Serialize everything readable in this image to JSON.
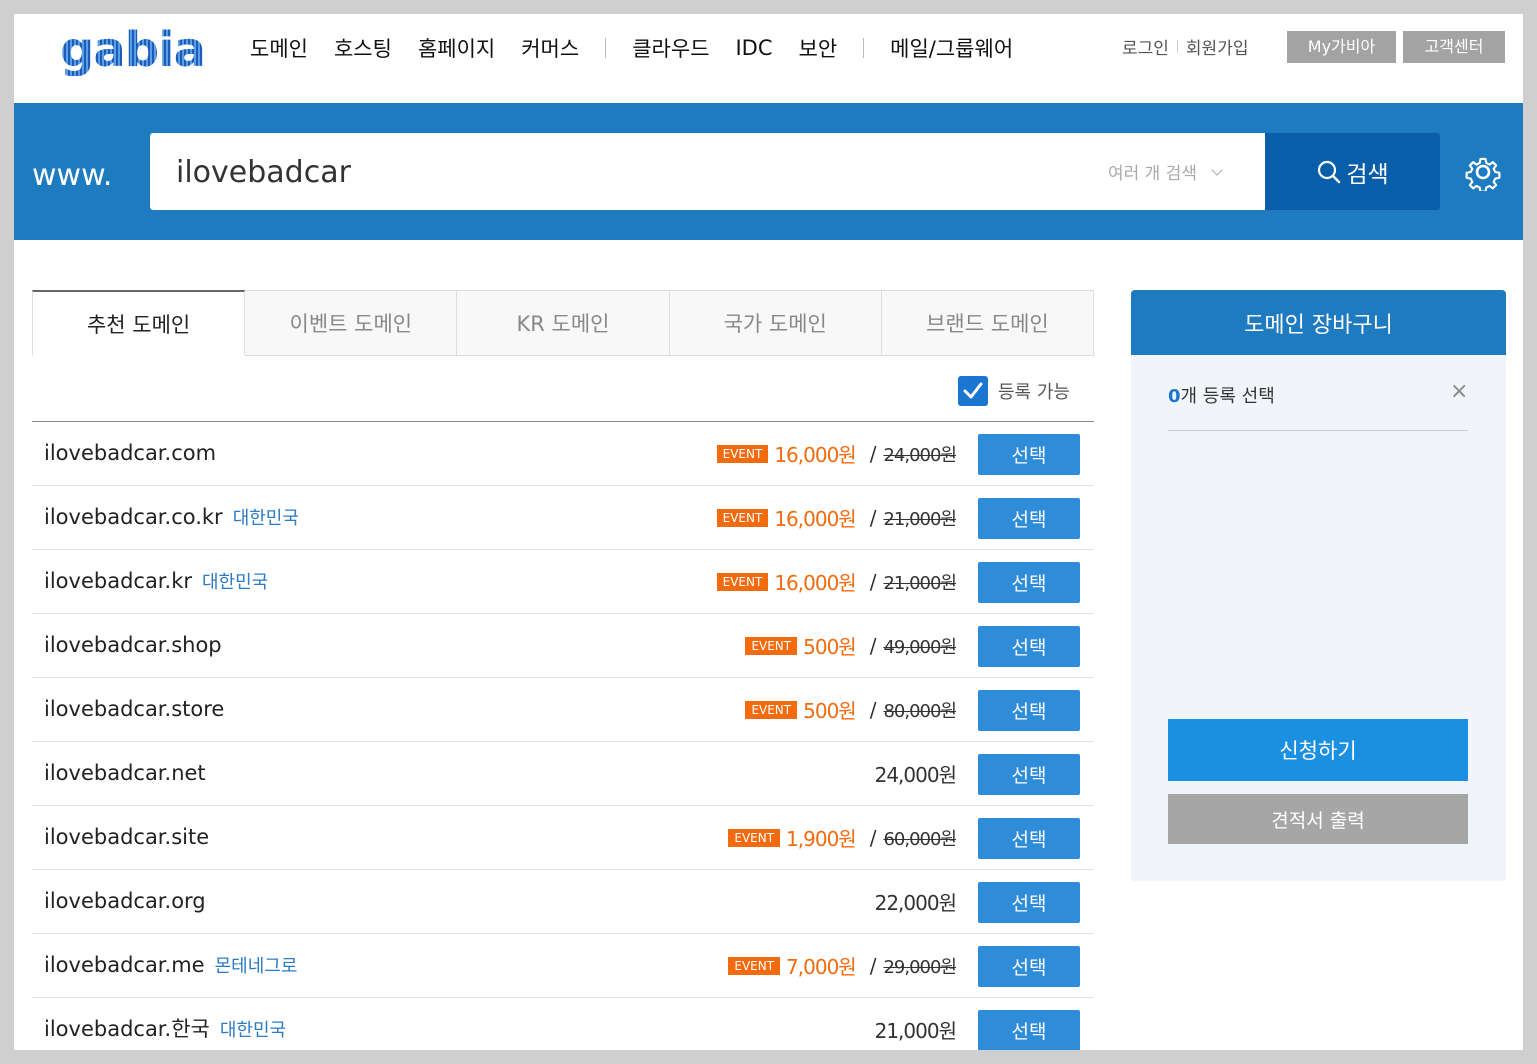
{
  "header": {
    "logo": "gabia.",
    "menu": [
      "도메인",
      "호스팅",
      "홈페이지",
      "커머스",
      "클라우드",
      "IDC",
      "보안",
      "메일/그룹웨어"
    ],
    "login": "로그인",
    "signup": "회원가입",
    "my_gabia": "My가비아",
    "support": "고객센터"
  },
  "search": {
    "prefix": "www.",
    "value": "ilovebadcar",
    "multi_label": "여러 개 검색",
    "button_label": "검색"
  },
  "tabs": [
    "추천 도메인",
    "이벤트 도메인",
    "KR 도메인",
    "국가 도메인",
    "브랜드 도메인"
  ],
  "filter": {
    "label": "등록 가능",
    "checked": true
  },
  "domains": [
    {
      "name": "ilovebadcar.com",
      "country": "",
      "event": "EVENT",
      "sale": "16,000원",
      "price": "24,000원",
      "select": "선택"
    },
    {
      "name": "ilovebadcar.co.kr",
      "country": "대한민국",
      "event": "EVENT",
      "sale": "16,000원",
      "price": "21,000원",
      "select": "선택"
    },
    {
      "name": "ilovebadcar.kr",
      "country": "대한민국",
      "event": "EVENT",
      "sale": "16,000원",
      "price": "21,000원",
      "select": "선택"
    },
    {
      "name": "ilovebadcar.shop",
      "country": "",
      "event": "EVENT",
      "sale": "500원",
      "price": "49,000원",
      "select": "선택"
    },
    {
      "name": "ilovebadcar.store",
      "country": "",
      "event": "EVENT",
      "sale": "500원",
      "price": "80,000원",
      "select": "선택"
    },
    {
      "name": "ilovebadcar.net",
      "country": "",
      "event": "",
      "sale": "",
      "price": "24,000원",
      "select": "선택"
    },
    {
      "name": "ilovebadcar.site",
      "country": "",
      "event": "EVENT",
      "sale": "1,900원",
      "price": "60,000원",
      "select": "선택"
    },
    {
      "name": "ilovebadcar.org",
      "country": "",
      "event": "",
      "sale": "",
      "price": "22,000원",
      "select": "선택"
    },
    {
      "name": "ilovebadcar.me",
      "country": "몬테네그로",
      "event": "EVENT",
      "sale": "7,000원",
      "price": "29,000원",
      "select": "선택"
    },
    {
      "name": "ilovebadcar.한국",
      "country": "대한민국",
      "event": "",
      "sale": "",
      "price": "21,000원",
      "select": "선택"
    }
  ],
  "cart": {
    "title": "도메인 장바구니",
    "count": "0",
    "count_suffix": "개 등록 선택",
    "close": "×",
    "apply": "신청하기",
    "quote": "견적서 출력"
  },
  "colors": {
    "brand_blue": "#1f7bc0",
    "event_orange": "#f26b0f",
    "select_blue": "#2f8cd9"
  }
}
